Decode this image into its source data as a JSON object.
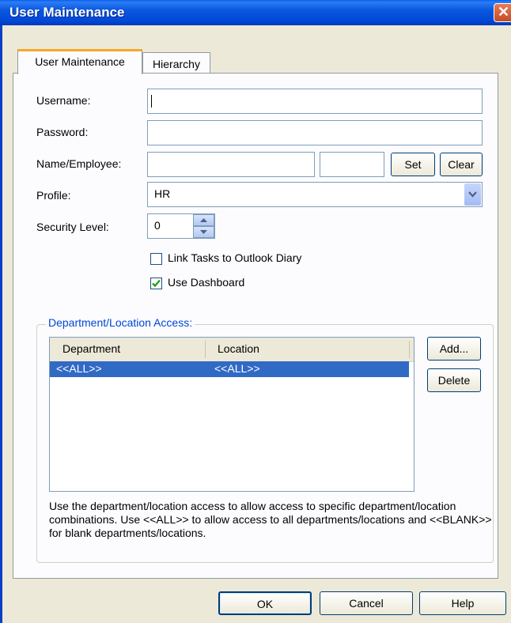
{
  "window": {
    "title": "User Maintenance",
    "close_glyph": "✕"
  },
  "tabs": [
    {
      "label": "User Maintenance",
      "active": true
    },
    {
      "label": "Hierarchy",
      "active": false
    }
  ],
  "form": {
    "username": {
      "label": "Username:",
      "value": ""
    },
    "password": {
      "label": "Password:",
      "value": ""
    },
    "name_employee": {
      "label": "Name/Employee:",
      "value1": "",
      "value2": "",
      "set_label": "Set",
      "clear_label": "Clear"
    },
    "profile": {
      "label": "Profile:",
      "value": "HR"
    },
    "security_level": {
      "label": "Security Level:",
      "value": "0"
    },
    "link_tasks": {
      "label": "Link Tasks to Outlook Diary",
      "checked": false
    },
    "use_dashboard": {
      "label": "Use Dashboard",
      "checked": true
    }
  },
  "access": {
    "group_title": "Department/Location Access:",
    "columns": [
      "Department",
      "Location"
    ],
    "rows": [
      {
        "department": "<<ALL>>",
        "location": "<<ALL>>",
        "selected": true
      }
    ],
    "add_label": "Add...",
    "delete_label": "Delete",
    "note": "Use the department/location access to allow access to specific department/location combinations. Use <<ALL>> to allow access to all departments/locations and <<BLANK>> for blank departments/locations."
  },
  "footer": {
    "ok_label": "OK",
    "cancel_label": "Cancel",
    "help_label": "Help"
  },
  "colors": {
    "title_bar": "#0046d5",
    "selection": "#316ac5",
    "group_title": "#0046d5",
    "tab_accent": "#f6a828"
  }
}
